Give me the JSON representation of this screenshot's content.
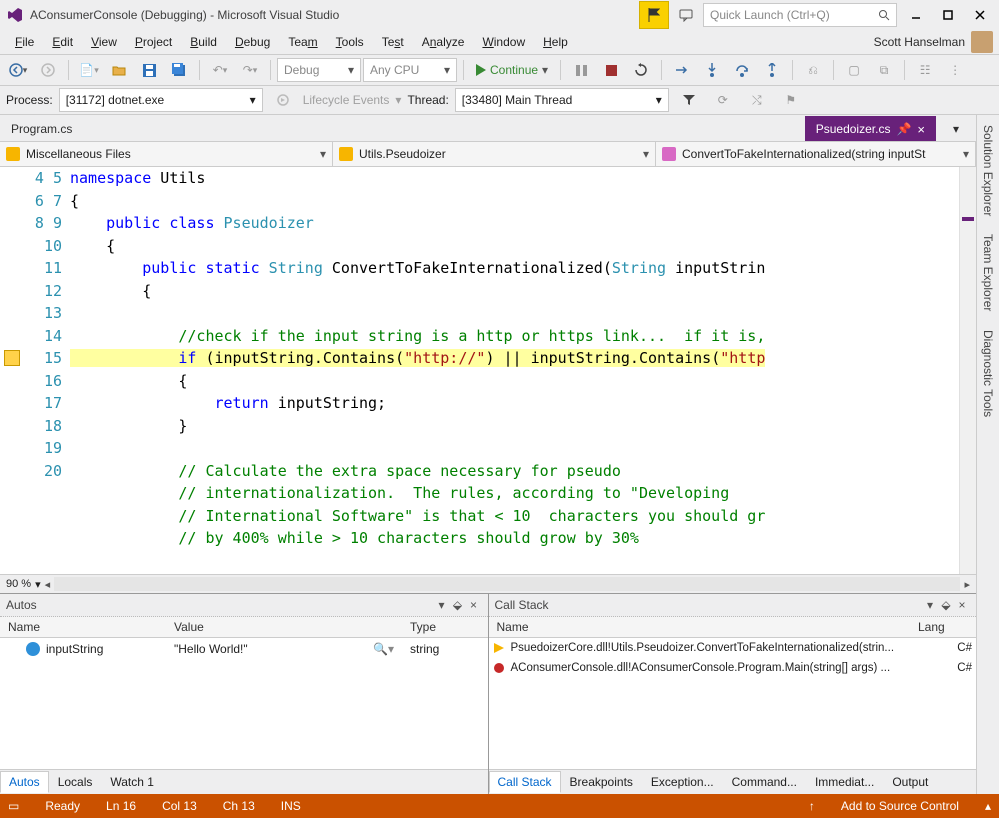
{
  "title": "AConsumerConsole (Debugging) - Microsoft Visual Studio",
  "quicklaunch_placeholder": "Quick Launch (Ctrl+Q)",
  "user": "Scott Hanselman",
  "menu": [
    "File",
    "Edit",
    "View",
    "Project",
    "Build",
    "Debug",
    "Team",
    "Tools",
    "Test",
    "Analyze",
    "Window",
    "Help"
  ],
  "toolbar": {
    "config": "Debug",
    "platform": "Any CPU",
    "continue": "Continue"
  },
  "process": {
    "label": "Process:",
    "value": "[31172] dotnet.exe",
    "lifecycle": "Lifecycle Events",
    "thread_label": "Thread:",
    "thread_value": "[33480] Main Thread"
  },
  "tabs": {
    "left": "Program.cs",
    "right": "Psuedoizer.cs"
  },
  "nav": {
    "a": "Miscellaneous Files",
    "b": "Utils.Pseudoizer",
    "c": "ConvertToFakeInternationalized(string inputSt"
  },
  "right_tabs": [
    "Solution Explorer",
    "Team Explorer",
    "Diagnostic Tools"
  ],
  "code": {
    "lines": [
      4,
      5,
      6,
      7,
      8,
      9,
      10,
      11,
      12,
      13,
      14,
      15,
      16,
      17,
      18,
      19,
      20
    ],
    "l4_a": "namespace",
    "l4_b": " Utils",
    "l5": "{",
    "l6_a": "    public",
    "l6_b": " class",
    "l6_c": " Pseudoizer",
    "l7": "    {",
    "l8_a": "        public",
    "l8_b": " static",
    "l8_c": " String",
    "l8_d": " ConvertToFakeInternationalized(",
    "l8_e": "String",
    "l8_f": " inputStrin",
    "l9": "        {",
    "l10": "",
    "l11": "            //check if the input string is a http or https link...  if it is, ",
    "l12_a": "            ",
    "l12_b": "if",
    "l12_c": " (inputString.Contains(",
    "l12_d": "\"http://\"",
    "l12_e": ") || inputString.Contains(",
    "l12_f": "\"http",
    "l13": "            {",
    "l14_a": "                ",
    "l14_b": "return",
    "l14_c": " inputString;",
    "l15": "            }",
    "l16": "",
    "l17": "            // Calculate the extra space necessary for pseudo",
    "l18": "            // internationalization.  The rules, according to \"Developing",
    "l19": "            // International Software\" is that < 10  characters you should gr",
    "l20": "            // by 400% while > 10 characters should grow by 30%"
  },
  "zoom": "90 %",
  "autos": {
    "title": "Autos",
    "cols": {
      "name": "Name",
      "value": "Value",
      "type": "Type"
    },
    "row": {
      "name": "inputString",
      "value": "\"Hello World!\"",
      "type": "string"
    },
    "tabs": [
      "Autos",
      "Locals",
      "Watch 1"
    ]
  },
  "callstack": {
    "title": "Call Stack",
    "cols": {
      "name": "Name",
      "lang": "Lang"
    },
    "rows": [
      {
        "text": "PsuedoizerCore.dll!Utils.Pseudoizer.ConvertToFakeInternationalized(strin...",
        "lang": "C#",
        "cur": true
      },
      {
        "text": "AConsumerConsole.dll!AConsumerConsole.Program.Main(string[] args) ...",
        "lang": "C#",
        "cur": false
      }
    ],
    "tabs": [
      "Call Stack",
      "Breakpoints",
      "Exception...",
      "Command...",
      "Immediat...",
      "Output"
    ]
  },
  "status": {
    "ready": "Ready",
    "ln": "Ln 16",
    "col": "Col 13",
    "ch": "Ch 13",
    "ins": "INS",
    "scc": "Add to Source Control"
  }
}
